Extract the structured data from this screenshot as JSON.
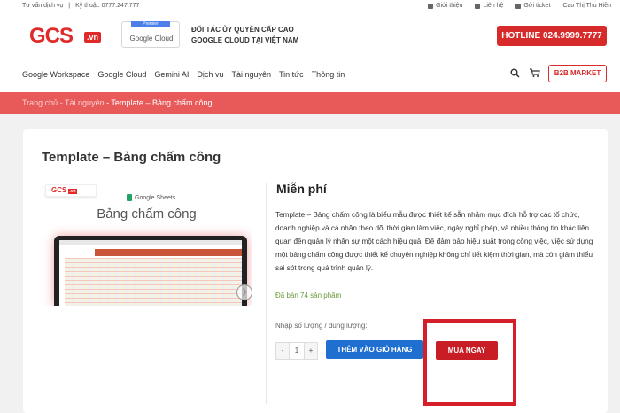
{
  "topbar": {
    "consult": "Tư vấn dịch vụ",
    "sep": "|",
    "tech": "Kỹ thuật: 0777.247.777",
    "about": "Giới thiệu",
    "contact": "Liên hệ",
    "ticket": "Gửi ticket",
    "user": "Cao Thị Thu Hiền"
  },
  "header": {
    "logo_text": "GCS",
    "logo_suffix": ".vn",
    "badge_top": "Premier",
    "badge_name": "Google Cloud",
    "partner_line1": "ĐỐI TÁC ỦY QUYỀN CẤP CAO",
    "partner_line2": "GOOGLE CLOUD TẠI VIỆT NAM",
    "hotline": "HOTLINE 024.9999.7777",
    "b2b": "B2B MARKET"
  },
  "nav": {
    "items": [
      "Google Workspace",
      "Google Cloud",
      "Gemini AI",
      "Dịch vụ",
      "Tài nguyên",
      "Tin tức",
      "Thông tin"
    ]
  },
  "breadcrumb": {
    "home": "Trang chủ",
    "sep": " - ",
    "section": "Tài nguyên",
    "current": "Template – Bảng chấm công"
  },
  "product": {
    "title": "Template – Bảng chấm công",
    "image": {
      "logo": "GCS",
      "logo_suffix": ".vn",
      "app": "Google Sheets",
      "heading": "Bảng chấm công"
    },
    "price": "Miễn phí",
    "description": "Template – Bảng chấm công là biểu mẫu được thiết kế sẵn nhằm mục đích hỗ trợ các tổ chức, doanh nghiệp và cá nhân theo dõi thời gian làm việc, ngày nghỉ phép, và nhiều thông tin khác liên quan đến quản lý nhân sự một cách hiệu quả. Để đảm bảo hiệu suất trong công việc, việc sử dụng một bảng chấm công được thiết kế chuyên nghiệp không chỉ tiết kiệm thời gian, mà còn giảm thiểu sai sót trong quá trình quản lý.",
    "sold": "Đã bán 74 sản phẩm",
    "qty_label": "Nhập số lượng / dung lượng:",
    "qty_minus": "-",
    "qty_value": "1",
    "qty_plus": "+",
    "add_to_cart": "THÊM VÀO GIỎ HÀNG",
    "buy_now": "MUA NGAY"
  },
  "colors": {
    "brand_red": "#d72a2a",
    "breadcrumb_bg": "#e85a5a",
    "cart_blue": "#1f6fd1",
    "highlight_red": "#d41f2a"
  }
}
